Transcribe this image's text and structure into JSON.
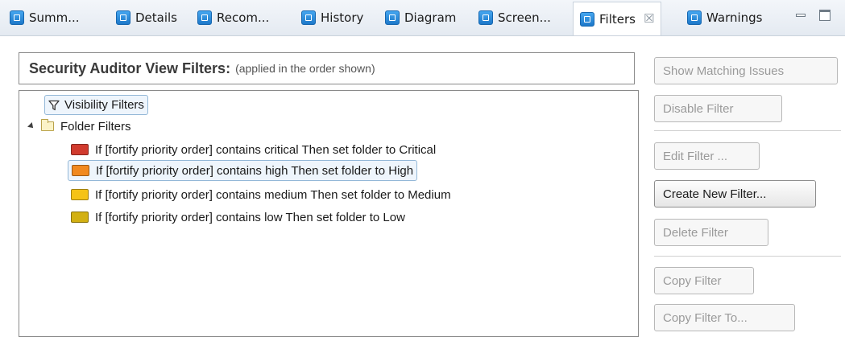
{
  "tabs": [
    {
      "label": "Summ...",
      "active": false
    },
    {
      "label": "Details",
      "active": false
    },
    {
      "label": "Recom...",
      "active": false
    },
    {
      "label": "History",
      "active": false
    },
    {
      "label": "Diagram",
      "active": false
    },
    {
      "label": "Screen...",
      "active": false
    },
    {
      "label": "Filters",
      "active": true
    },
    {
      "label": "Warnings",
      "active": false
    }
  ],
  "tab_close_glyph": "☒",
  "panel": {
    "title": "Security Auditor View Filters:",
    "subtitle": "(applied in the order shown)"
  },
  "tree": {
    "visibility_label": "Visibility Filters",
    "folder_label": "Folder Filters",
    "rules": [
      {
        "label": "If [fortify priority order] contains critical Then set folder to Critical",
        "color": "#d13b2e"
      },
      {
        "label": "If [fortify priority order] contains high Then set folder to High",
        "color": "#f1891f"
      },
      {
        "label": "If [fortify priority order] contains medium Then set folder to Medium",
        "color": "#f5c316"
      },
      {
        "label": "If [fortify priority order] contains low Then set folder to Low",
        "color": "#d2b012"
      }
    ]
  },
  "buttons": {
    "show_matching": "Show Matching Issues",
    "disable_filter": "Disable Filter",
    "edit_filter": "Edit Filter ...",
    "create_new_filter": "Create New Filter...",
    "delete_filter": "Delete Filter",
    "copy_filter": "Copy Filter",
    "copy_filter_to": "Copy Filter To..."
  },
  "icons": {
    "tab_icon": "document-icon",
    "visibility_icon": "funnel-icon",
    "folder_icon": "folder-icon"
  }
}
